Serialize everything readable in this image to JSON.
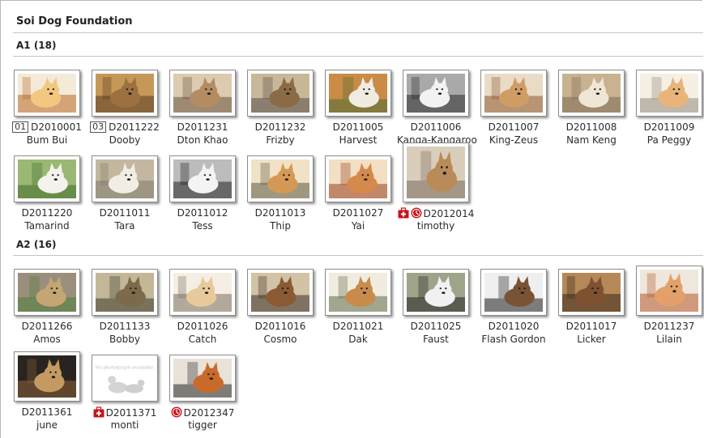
{
  "page": {
    "title": "Soi Dog Foundation"
  },
  "icons": {
    "medical": "first-aid-kit-icon",
    "clock": "clock-icon"
  },
  "colors": {
    "icon_red": "#c8141c",
    "rule": "#c4c4c4",
    "thumb_border": "#8e8e8e"
  },
  "sections": [
    {
      "title": "A1 (18)",
      "animals": [
        {
          "code": "D2010001",
          "name": "Bum Bui",
          "badge": "01",
          "medical": false,
          "clock": false,
          "photo": true,
          "palette": [
            "#b76a2a",
            "#f2c880",
            "#f3ead8"
          ]
        },
        {
          "code": "D2011222",
          "name": "Dooby",
          "badge": "03",
          "medical": false,
          "clock": false,
          "photo": true,
          "palette": [
            "#5a3b22",
            "#9d7040",
            "#c59858"
          ]
        },
        {
          "code": "D2011231",
          "name": "Dton Khao",
          "badge": "",
          "medical": false,
          "clock": false,
          "photo": true,
          "palette": [
            "#6a5542",
            "#b48c62",
            "#dccbb0"
          ]
        },
        {
          "code": "D2011232",
          "name": "Frizby",
          "badge": "",
          "medical": false,
          "clock": false,
          "photo": true,
          "palette": [
            "#55504a",
            "#8a6b45",
            "#c9b79a"
          ]
        },
        {
          "code": "D2011005",
          "name": "Harvest",
          "badge": "",
          "medical": false,
          "clock": false,
          "photo": true,
          "palette": [
            "#4a6e34",
            "#f0ece2",
            "#c98b45"
          ]
        },
        {
          "code": "D2011006",
          "name": "Kanga-Kangaroo",
          "badge": "",
          "medical": false,
          "clock": false,
          "photo": true,
          "palette": [
            "#2b2b2b",
            "#f2f2f2",
            "#a9a9a9"
          ]
        },
        {
          "code": "D2011007",
          "name": "King-Zeus",
          "badge": "",
          "medical": false,
          "clock": false,
          "photo": true,
          "palette": [
            "#8c5a30",
            "#cf9d63",
            "#e9dcc7"
          ]
        },
        {
          "code": "D2011008",
          "name": "Nam Keng",
          "badge": "",
          "medical": false,
          "clock": false,
          "photo": true,
          "palette": [
            "#7b6a58",
            "#efe6d6",
            "#c9b28f"
          ]
        },
        {
          "code": "D2011009",
          "name": "Pa Peggy",
          "badge": "",
          "medical": false,
          "clock": false,
          "photo": true,
          "palette": [
            "#8f8a80",
            "#e8b47a",
            "#f6efe4"
          ]
        },
        {
          "code": "D2011220",
          "name": "Tamarind",
          "badge": "",
          "medical": false,
          "clock": false,
          "photo": true,
          "palette": [
            "#3f6a2a",
            "#f4f2ec",
            "#9ab873"
          ]
        },
        {
          "code": "D2011011",
          "name": "Tara",
          "badge": "",
          "medical": false,
          "clock": false,
          "photo": true,
          "palette": [
            "#7d7a6a",
            "#f0ede5",
            "#c3b89f"
          ]
        },
        {
          "code": "D2011012",
          "name": "Tess",
          "badge": "",
          "medical": false,
          "clock": false,
          "photo": true,
          "palette": [
            "#222222",
            "#f4f4f4",
            "#bcbcbc"
          ]
        },
        {
          "code": "D2011013",
          "name": "Thip",
          "badge": "",
          "medical": false,
          "clock": false,
          "photo": true,
          "palette": [
            "#5b5b48",
            "#d49a55",
            "#f1e2c6"
          ]
        },
        {
          "code": "D2011027",
          "name": "Yai",
          "badge": "",
          "medical": false,
          "clock": false,
          "photo": true,
          "palette": [
            "#9a3f1f",
            "#d48a4a",
            "#f2dfc4"
          ]
        },
        {
          "code": "D2012014",
          "name": "timothy",
          "badge": "",
          "medical": true,
          "clock": true,
          "photo": true,
          "palette": [
            "#7a6c5c",
            "#b88b58",
            "#d9cdbb"
          ]
        }
      ]
    },
    {
      "title": "A2 (16)",
      "animals": [
        {
          "code": "D2011266",
          "name": "Amos",
          "badge": "",
          "medical": false,
          "clock": false,
          "photo": true,
          "palette": [
            "#4f7d3a",
            "#c4a574",
            "#9a8f7c"
          ]
        },
        {
          "code": "D2011133",
          "name": "Bobby",
          "badge": "",
          "medical": false,
          "clock": false,
          "photo": true,
          "palette": [
            "#3a3a2e",
            "#7d6a4a",
            "#c4b797"
          ]
        },
        {
          "code": "D2011026",
          "name": "Catch",
          "badge": "",
          "medical": false,
          "clock": false,
          "photo": true,
          "palette": [
            "#7b715f",
            "#e7c99b",
            "#f4eee4"
          ]
        },
        {
          "code": "D2011016",
          "name": "Cosmo",
          "badge": "",
          "medical": false,
          "clock": false,
          "photo": true,
          "palette": [
            "#3b3026",
            "#8a5a34",
            "#d3c3a6"
          ]
        },
        {
          "code": "D2011021",
          "name": "Dak",
          "badge": "",
          "medical": false,
          "clock": false,
          "photo": true,
          "palette": [
            "#5f6d4a",
            "#c98b4c",
            "#f1ece0"
          ]
        },
        {
          "code": "D2011025",
          "name": "Faust",
          "badge": "",
          "medical": false,
          "clock": false,
          "photo": true,
          "palette": [
            "#212121",
            "#f1f1f1",
            "#9ea48a"
          ]
        },
        {
          "code": "D2011020",
          "name": "Flash Gordon",
          "badge": "",
          "medical": false,
          "clock": false,
          "photo": true,
          "palette": [
            "#1e1e1e",
            "#7a5236",
            "#efefef"
          ]
        },
        {
          "code": "D2011017",
          "name": "Licker",
          "badge": "",
          "medical": false,
          "clock": false,
          "photo": true,
          "palette": [
            "#3a2a1e",
            "#7e5230",
            "#b58858"
          ]
        },
        {
          "code": "D2011237",
          "name": "Lilain",
          "badge": "",
          "medical": false,
          "clock": false,
          "photo": true,
          "palette": [
            "#b55a2c",
            "#e4a06a",
            "#efe7dc"
          ]
        },
        {
          "code": "D2011361",
          "name": "june",
          "badge": "",
          "medical": false,
          "clock": false,
          "photo": true,
          "palette": [
            "#8a6238",
            "#c49a62",
            "#2a2420"
          ]
        },
        {
          "code": "D2011371",
          "name": "monti",
          "badge": "",
          "medical": true,
          "clock": false,
          "photo": false,
          "placeholder": "No photograph available.",
          "palette": [
            "#e6e6e6",
            "#c9c9c9",
            "#ffffff"
          ]
        },
        {
          "code": "D2012347",
          "name": "tigger",
          "badge": "",
          "medical": false,
          "clock": true,
          "photo": true,
          "palette": [
            "#2a2a2a",
            "#c96a2a",
            "#e8e2d8"
          ]
        }
      ]
    }
  ]
}
